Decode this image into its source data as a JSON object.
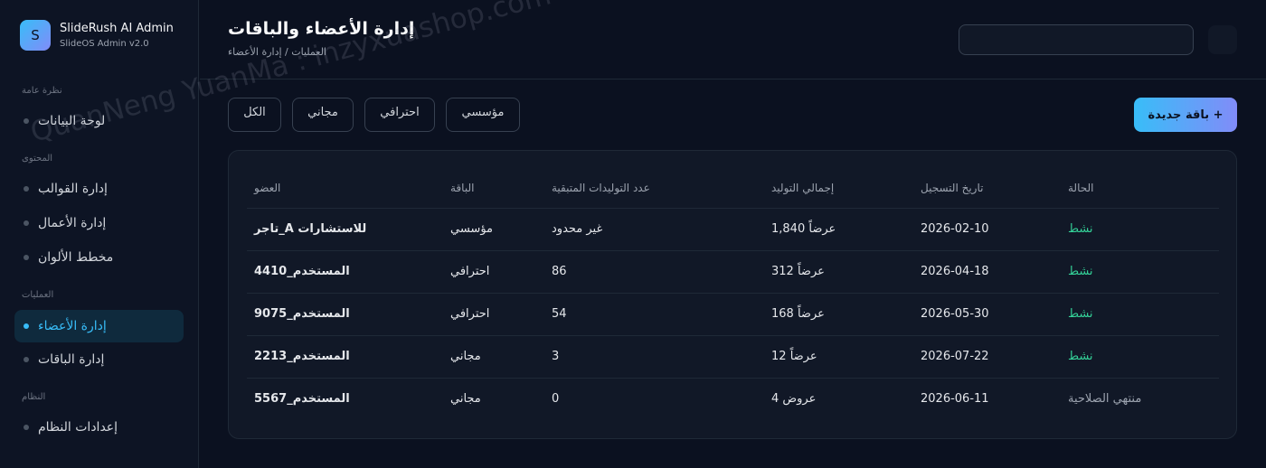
{
  "app": {
    "logo_letter": "S",
    "name": "SlideRush AI Admin",
    "version": "SlideOS Admin v2.0"
  },
  "sidebar": {
    "sections": [
      {
        "label": "نظرة عامة",
        "items": [
          {
            "label": "لوحة البيانات",
            "active": false
          }
        ]
      },
      {
        "label": "المحتوى",
        "items": [
          {
            "label": "إدارة القوالب",
            "active": false
          },
          {
            "label": "إدارة الأعمال",
            "active": false
          },
          {
            "label": "مخطط الألوان",
            "active": false
          }
        ]
      },
      {
        "label": "العمليات",
        "items": [
          {
            "label": "إدارة الأعضاء",
            "active": true
          },
          {
            "label": "إدارة الباقات",
            "active": false
          }
        ]
      },
      {
        "label": "النظام",
        "items": [
          {
            "label": "إعدادات النظام",
            "active": false
          }
        ]
      }
    ]
  },
  "header": {
    "title": "إدارة الأعضاء والباقات",
    "breadcrumb": "العمليات / إدارة الأعضاء",
    "search_value": ""
  },
  "filters": [
    "الكل",
    "مجاني",
    "احترافي",
    "مؤسسي"
  ],
  "new_plan_button": "باقة جديدة +",
  "table": {
    "headers": [
      "العضو",
      "الباقة",
      "عدد التوليدات المتبقية",
      "إجمالي التوليد",
      "تاريخ التسجيل",
      "الحالة"
    ],
    "rows": [
      {
        "member": "تاجر_A للاستشارات",
        "plan": "مؤسسي",
        "remaining": "غير محدود",
        "total": "1,840 عرضاً",
        "date": "2026-02-10",
        "status": "نشط",
        "status_type": "active"
      },
      {
        "member": "المستخدم_4410",
        "plan": "احترافي",
        "remaining": "86",
        "total": "312 عرضاً",
        "date": "2026-04-18",
        "status": "نشط",
        "status_type": "active"
      },
      {
        "member": "المستخدم_9075",
        "plan": "احترافي",
        "remaining": "54",
        "total": "168 عرضاً",
        "date": "2026-05-30",
        "status": "نشط",
        "status_type": "active"
      },
      {
        "member": "المستخدم_2213",
        "plan": "مجاني",
        "remaining": "3",
        "total": "12 عرضاً",
        "date": "2026-07-22",
        "status": "نشط",
        "status_type": "active"
      },
      {
        "member": "المستخدم_5567",
        "plan": "مجاني",
        "remaining": "0",
        "total": "4 عروض",
        "date": "2026-06-11",
        "status": "منتهي الصلاحية",
        "status_type": "expired"
      }
    ]
  },
  "watermark": "QuanNeng YuanMa : inzyxuashop.com",
  "colors": {
    "accent": "#38bdf8",
    "accent_gradient_end": "#818cf8",
    "status_active": "#34d399",
    "status_expired": "#9ca3af"
  }
}
